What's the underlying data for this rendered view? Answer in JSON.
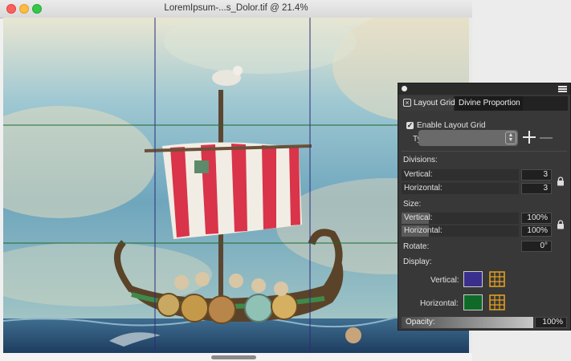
{
  "window": {
    "title": "LoremIpsum-...s_Dolor.tif @ 21.4%"
  },
  "panel": {
    "tabs": {
      "active": "Layout Grid",
      "inactive": "Divine Proportion"
    },
    "enable_label": "Enable Layout Grid",
    "enable_checked": true,
    "type_label": "Type:",
    "type_value": "",
    "divisions_label": "Divisions:",
    "vertical_label": "Vertical:",
    "vertical_divisions": "3",
    "horizontal_label": "Horizontal:",
    "horizontal_divisions": "3",
    "size_label": "Size:",
    "size_vertical_label": "Vertical:",
    "size_vertical_value": "100%",
    "size_horizontal_label": "Horizontal:",
    "size_horizontal_value": "100%",
    "rotate_label": "Rotate:",
    "rotate_value": "0°",
    "display_label": "Display:",
    "display_vertical_label": "Vertical:",
    "display_vertical_color": "#3a2f8c",
    "display_horizontal_label": "Horizontal:",
    "display_horizontal_color": "#0f6a2a",
    "opacity_label": "Opacity:",
    "opacity_value": "100%"
  },
  "icons": [
    "close-icon",
    "menu-icon",
    "plus-icon",
    "minus-icon",
    "lock-icon",
    "grid-icon",
    "stepper-icon"
  ]
}
